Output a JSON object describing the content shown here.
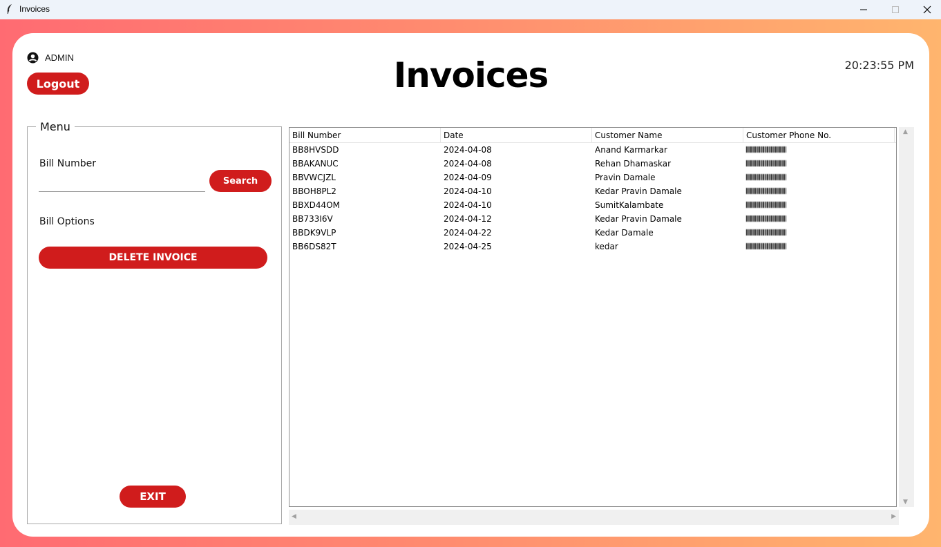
{
  "window": {
    "title": "Invoices"
  },
  "header": {
    "user": "ADMIN",
    "logout_label": "Logout",
    "page_title": "Invoices",
    "clock": "20:23:55 PM"
  },
  "menu": {
    "legend": "Menu",
    "bill_number_label": "Bill Number",
    "bill_number_value": "",
    "search_label": "Search",
    "bill_options_label": "Bill Options",
    "delete_label": "DELETE INVOICE",
    "exit_label": "EXIT"
  },
  "table": {
    "columns": [
      "Bill Number",
      "Date",
      "Customer Name",
      "Customer Phone No."
    ],
    "rows": [
      [
        "BB8HVSDD",
        "2024-04-08",
        "Anand Karmarkar",
        ""
      ],
      [
        "BBAKANUC",
        "2024-04-08",
        "Rehan Dhamaskar",
        ""
      ],
      [
        "BBVWCJZL",
        "2024-04-09",
        "Pravin Damale",
        ""
      ],
      [
        "BBOH8PL2",
        "2024-04-10",
        "Kedar Pravin Damale",
        ""
      ],
      [
        "BBXD44OM",
        "2024-04-10",
        "SumitKalambate",
        ""
      ],
      [
        "BB733I6V",
        "2024-04-12",
        "Kedar Pravin Damale",
        ""
      ],
      [
        "BBDK9VLP",
        "2024-04-22",
        "Kedar Damale",
        ""
      ],
      [
        "BB6DS82T",
        "2024-04-25",
        "kedar",
        ""
      ]
    ]
  },
  "colors": {
    "accent": "#d01c1c",
    "gradient_start": "#ff6b72",
    "gradient_end": "#ffb56e"
  }
}
